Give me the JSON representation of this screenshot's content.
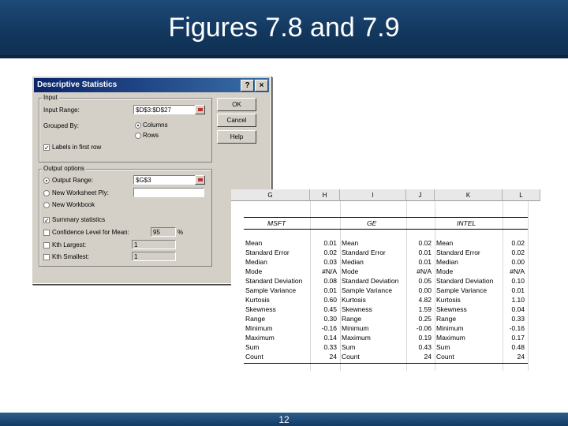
{
  "slide": {
    "title": "Figures 7.8 and 7.9",
    "page_number": "12"
  },
  "dialog": {
    "title": "Descriptive Statistics",
    "help_button": "?",
    "close_button": "×",
    "input_group": "Input",
    "input_range_label": "Input Range:",
    "input_range_value": "$D$3:$D$27",
    "grouped_by_label": "Grouped By:",
    "columns_label": "Columns",
    "rows_label": "Rows",
    "labels_first_row": "Labels in first row",
    "output_group": "Output options",
    "output_range_label": "Output Range:",
    "output_range_value": "$G$3",
    "new_worksheet_ply": "New Worksheet Ply:",
    "new_workbook": "New Workbook",
    "summary_statistics": "Summary statistics",
    "confidence_level": "Confidence Level for Mean:",
    "confidence_value": "95",
    "percent": "%",
    "kth_largest": "Kth Largest:",
    "kth_largest_value": "1",
    "kth_smallest": "Kth Smallest:",
    "kth_smallest_value": "1",
    "ok": "OK",
    "cancel": "Cancel",
    "help": "Help",
    "checked_mark": "✓"
  },
  "sheet": {
    "columns": [
      "G",
      "H",
      "I",
      "J",
      "K",
      "L"
    ],
    "groups": [
      "MSFT",
      "GE",
      "INTEL"
    ],
    "stats": [
      "Mean",
      "Standard Error",
      "Median",
      "Mode",
      "Standard Deviation",
      "Sample Variance",
      "Kurtosis",
      "Skewness",
      "Range",
      "Minimum",
      "Maximum",
      "Sum",
      "Count"
    ],
    "msft": [
      "0.01",
      "0.02",
      "0.03",
      "#N/A",
      "0.08",
      "0.01",
      "0.60",
      "0.45",
      "0.30",
      "-0.16",
      "0.14",
      "0.33",
      "24"
    ],
    "ge": [
      "0.02",
      "0.01",
      "0.01",
      "#N/A",
      "0.05",
      "0.00",
      "4.82",
      "1.59",
      "0.25",
      "-0.06",
      "0.19",
      "0.43",
      "24"
    ],
    "intel": [
      "0.02",
      "0.02",
      "0.00",
      "#N/A",
      "0.10",
      "0.01",
      "1.10",
      "0.04",
      "0.33",
      "-0.16",
      "0.17",
      "0.48",
      "24"
    ]
  }
}
